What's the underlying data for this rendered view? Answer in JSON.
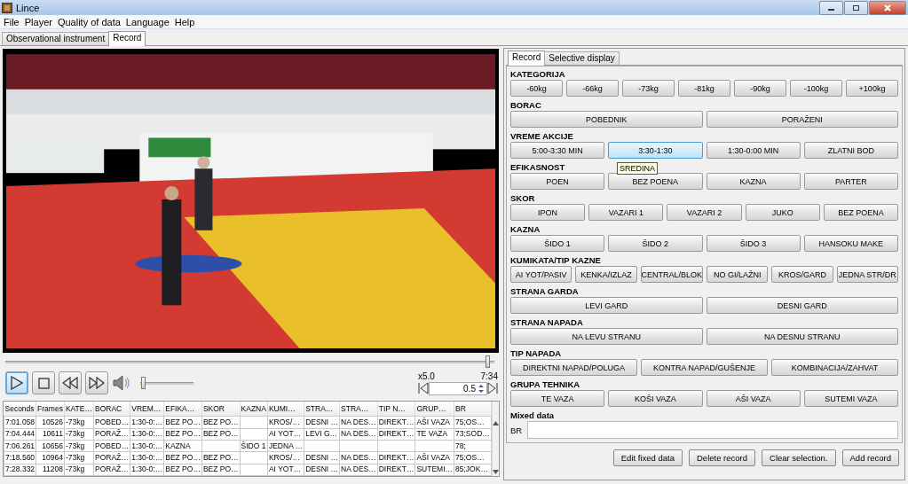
{
  "window": {
    "title": "Lince"
  },
  "menu": [
    "File",
    "Player",
    "Quality of data",
    "Language",
    "Help"
  ],
  "tabs": [
    {
      "label": "Observational instrument",
      "selected": false
    },
    {
      "label": "Record",
      "selected": true
    }
  ],
  "player": {
    "seek": {
      "level": 0.985
    },
    "buttons": [
      {
        "kind": "play",
        "selected": true
      },
      {
        "kind": "stop",
        "selected": false
      },
      {
        "kind": "rewind",
        "selected": false
      },
      {
        "kind": "forward",
        "selected": false
      }
    ],
    "volume": {
      "level": 0.05
    },
    "speed": "x5.0",
    "time": "7:34",
    "rate": "0.5"
  },
  "table": {
    "columns": [
      "Seconds",
      "Frames",
      "KATE…",
      "BORAC",
      "VREM…",
      "EFIKA…",
      "SKOR",
      "KAZNA",
      "KUMI…",
      "STRA…",
      "STRA…",
      "TIP N…",
      "GRUP…",
      "BR"
    ],
    "rows": [
      [
        "7:01.058",
        "10526",
        "-73kg",
        "POBED…",
        "1:30-0:…",
        "BEZ PO…",
        "BEZ PO…",
        "",
        "KROS/…",
        "DESNI …",
        "NA DES…",
        "DIREKT…",
        "AŠI VAZA",
        "75;OS…"
      ],
      [
        "7:04.444",
        "10611",
        "-73kg",
        "PORAŽ…",
        "1:30-0:…",
        "BEZ PO…",
        "BEZ PO…",
        "",
        "AI YOT…",
        "LEVI G…",
        "NA DES…",
        "DIREKT…",
        "TE VAZA",
        "73;SOD…"
      ],
      [
        "7:06.261",
        "10656",
        "-73kg",
        "POBED…",
        "1:30-0:…",
        "KAZNA",
        "",
        "ŠIDO 1",
        "JEDNA …",
        "",
        "",
        "",
        "",
        "78;"
      ],
      [
        "7:18.560",
        "10964",
        "-73kg",
        "PORAŽ…",
        "1:30-0:…",
        "BEZ PO…",
        "BEZ PO…",
        "",
        "KROS/…",
        "DESNI …",
        "NA DES…",
        "DIREKT…",
        "AŠI VAZA",
        "75;OS…"
      ],
      [
        "7:28.332",
        "11208",
        "-73kg",
        "PORAŽ…",
        "1:30-0:…",
        "BEZ PO…",
        "BEZ PO…",
        "",
        "AI YOT…",
        "DESNI …",
        "NA DES…",
        "DIREKT…",
        "SUTEMI…",
        "85;JOK…"
      ]
    ]
  },
  "panel": {
    "tabs": [
      {
        "label": "Record",
        "selected": true
      },
      {
        "label": "Selective display",
        "selected": false
      }
    ],
    "groups": [
      {
        "title": "KATEGORIJA",
        "buttons": [
          {
            "label": "-60kg",
            "selected": false
          },
          {
            "label": "-66kg",
            "selected": false
          },
          {
            "label": "-73kg",
            "selected": false
          },
          {
            "label": "-81kg",
            "selected": false
          },
          {
            "label": "-90kg",
            "selected": false
          },
          {
            "label": "-100kg",
            "selected": false
          },
          {
            "label": "+100kg",
            "selected": false
          }
        ]
      },
      {
        "title": "BORAC",
        "buttons": [
          {
            "label": "POBEDNIK",
            "selected": false
          },
          {
            "label": "PORAŽENI",
            "selected": false
          }
        ]
      },
      {
        "title": "VREME AKCIJE",
        "buttons": [
          {
            "label": "5:00-3:30 MIN",
            "selected": false
          },
          {
            "label": "3:30-1:30",
            "selected": true
          },
          {
            "label": "1:30-0:00 MIN",
            "selected": false
          },
          {
            "label": "ZLATNI BOD",
            "selected": false
          }
        ]
      },
      {
        "title": "EFIKASNOST",
        "buttons": [
          {
            "label": "POEN",
            "selected": false
          },
          {
            "label": "BEZ POENA",
            "selected": false,
            "tooltip": "SREDINA"
          },
          {
            "label": "KAZNA",
            "selected": false
          },
          {
            "label": "PARTER",
            "selected": false
          }
        ]
      },
      {
        "title": "SKOR",
        "buttons": [
          {
            "label": "IPON",
            "selected": false
          },
          {
            "label": "VAZARI 1",
            "selected": false
          },
          {
            "label": "VAZARI 2",
            "selected": false
          },
          {
            "label": "JUKO",
            "selected": false
          },
          {
            "label": "BEZ POENA",
            "selected": false
          }
        ]
      },
      {
        "title": "KAZNA",
        "buttons": [
          {
            "label": "ŠIDO 1",
            "selected": false
          },
          {
            "label": "ŠIDO 2",
            "selected": false
          },
          {
            "label": "ŠIDO 3",
            "selected": false
          },
          {
            "label": "HANSOKU MAKE",
            "selected": false
          }
        ]
      },
      {
        "title": "KUMIKATA/TIP KAZNE",
        "buttons": [
          {
            "label": "AI YOT/PASIV",
            "selected": false
          },
          {
            "label": "KENKA/IZLAZ",
            "selected": false
          },
          {
            "label": "CENTRAL/BLOK",
            "selected": false
          },
          {
            "label": "NO GI/LAŽNI",
            "selected": false
          },
          {
            "label": "KROS/GARD",
            "selected": false
          },
          {
            "label": "JEDNA STR/DR",
            "selected": false
          }
        ]
      },
      {
        "title": "STRANA GARDA",
        "buttons": [
          {
            "label": "LEVI GARD",
            "selected": false
          },
          {
            "label": "DESNI GARD",
            "selected": false
          }
        ]
      },
      {
        "title": "STRANA NAPADA",
        "buttons": [
          {
            "label": "NA LEVU STRANU",
            "selected": false
          },
          {
            "label": "NA DESNU STRANU",
            "selected": false
          }
        ]
      },
      {
        "title": "TIP NAPADA",
        "buttons": [
          {
            "label": "DIREKTNI NAPAD/POLUGA",
            "selected": false
          },
          {
            "label": "KONTRA NAPAD/GUŠENJE",
            "selected": false
          },
          {
            "label": "KOMBINACIJA/ZAHVAT",
            "selected": false
          }
        ]
      },
      {
        "title": "GRUPA TEHNIKA",
        "buttons": [
          {
            "label": "TE VAZA",
            "selected": false
          },
          {
            "label": "KOŠI VAZA",
            "selected": false
          },
          {
            "label": "AŠI VAZA",
            "selected": false
          },
          {
            "label": "SUTEMI VAZA",
            "selected": false
          }
        ]
      }
    ],
    "mixed": {
      "title": "Mixed data",
      "field_label": "BR"
    },
    "actions": [
      "Edit fixed data",
      "Delete record",
      "Clear selection.",
      "Add record"
    ]
  }
}
